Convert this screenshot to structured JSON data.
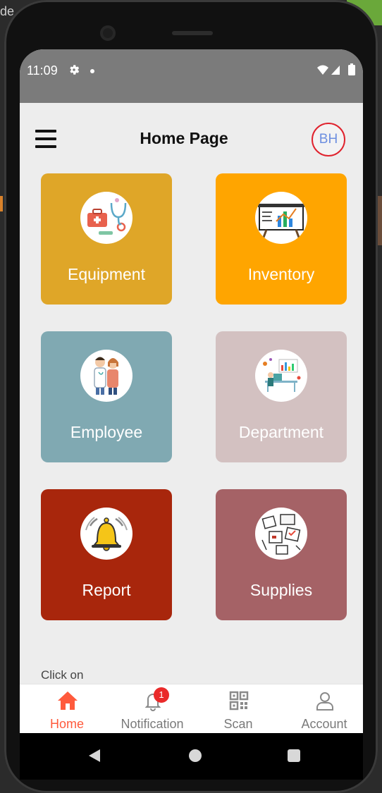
{
  "background": {
    "left_text": "de"
  },
  "status_bar": {
    "time": "11:09"
  },
  "header": {
    "title": "Home Page",
    "avatar_initials": "BH"
  },
  "tiles": [
    {
      "label": "Equipment",
      "color": "#DFA628",
      "icon": "medical-tools-icon"
    },
    {
      "label": "Inventory",
      "color": "#FFA500",
      "icon": "chart-board-icon"
    },
    {
      "label": "Employee",
      "color": "#80A9B2",
      "icon": "staff-people-icon"
    },
    {
      "label": "Department",
      "color": "#D3C1C1",
      "icon": "office-desk-icon"
    },
    {
      "label": "Report",
      "color": "#A8260C",
      "icon": "bell-icon"
    },
    {
      "label": "Supplies",
      "color": "#A56266",
      "icon": "boxes-icon"
    }
  ],
  "hint_text": "Click on",
  "bottom_nav": [
    {
      "label": "Home",
      "icon": "home-icon",
      "active": true
    },
    {
      "label": "Notification",
      "icon": "bell-outline-icon",
      "badge": "1"
    },
    {
      "label": "Scan",
      "icon": "qr-code-icon"
    },
    {
      "label": "Account",
      "icon": "person-icon"
    }
  ],
  "colors": {
    "accent": "#FF5A3C",
    "badge": "#EA2A2A",
    "avatar_ring": "#E0232E",
    "avatar_text": "#6D8FE0"
  }
}
